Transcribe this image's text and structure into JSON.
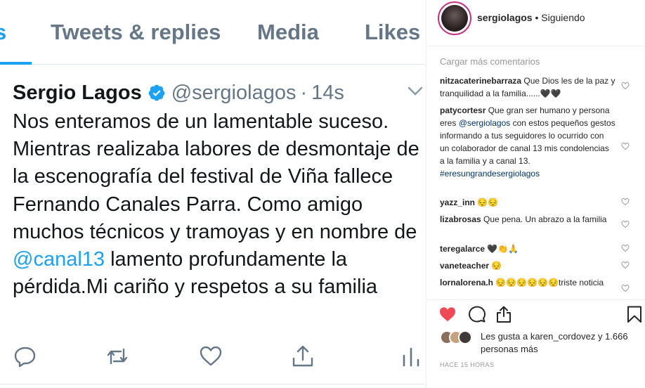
{
  "tweet": {
    "tabs": [
      {
        "label": "s"
      },
      {
        "label": "Tweets & replies"
      },
      {
        "label": "Media"
      },
      {
        "label": "Likes"
      }
    ],
    "author_name": "Sergio Lagos",
    "author_handle": "@sergiolagos",
    "separator": "·",
    "timestamp": "14s",
    "text_before_mention": "Nos enteramos de un lamentable suceso. Mientras realizaba labores de desmontaje de la escenografía del festival de Viña fallece Fernando Canales Parra. Como amigo muchos técnicos y tramoyas y en nombre de ",
    "mention": "@canal13",
    "text_after_mention": " lamento profundamente la pérdida.Mi cariño y respetos a su familia",
    "colors": {
      "accent": "#1da1f2",
      "text": "#14171a",
      "muted": "#657786"
    },
    "icons": [
      "verified-icon",
      "chevron-down-icon",
      "reply-icon",
      "retweet-icon",
      "like-icon",
      "share-icon",
      "analytics-icon"
    ]
  },
  "instagram": {
    "username": "sergiolagos",
    "follow_status": "• Siguiendo",
    "load_more": "Cargar más comentarios",
    "comments": [
      {
        "user": "nitzacaterinebarraza",
        "text": "Que Dios les de la paz y tranquilidad a la familia......🖤🖤"
      },
      {
        "user": "patycortesr",
        "text": "Que gran ser humano y persona eres ",
        "mention": "@sergiolagos",
        "text2": " con estos pequeños gestos informando a tus seguidores lo ocurrido con un colaborador de canal 13 mis condolencias a la familia y a canal 13. ",
        "hashtag": "#eresungrandesergiolagos"
      },
      {
        "user": "yazz_inn",
        "text": "😔😔"
      },
      {
        "user": "lizabrosas",
        "text": "Que pena. Un abrazo a la familia"
      },
      {
        "user": "teregalarce",
        "text": "🖤👏🙏"
      },
      {
        "user": "vaneteacher",
        "text": "😔"
      },
      {
        "user": "lornalorena.h",
        "text": "😔😔😔😔😔😔triste noticia"
      }
    ],
    "likes_prefix": "Les gusta a ",
    "likes_user": "karen_cordovez",
    "likes_suffix": " y 1.666 personas más",
    "time_ago": "HACE 15 HORAS",
    "colors": {
      "like_red": "#ed4956",
      "link": "#003569"
    },
    "icons": [
      "heart-filled-icon",
      "comment-icon",
      "share-icon",
      "bookmark-icon",
      "heart-outline-icon"
    ]
  }
}
